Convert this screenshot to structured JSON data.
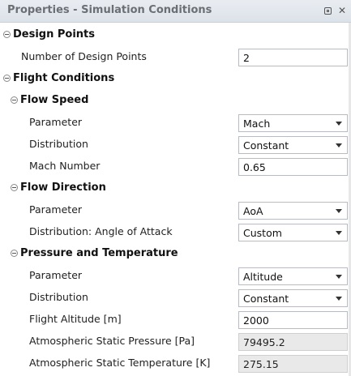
{
  "panel": {
    "title": "Properties - Simulation Conditions"
  },
  "design_points": {
    "label": "Design Points",
    "num_label": "Number of Design Points",
    "num_value": "2"
  },
  "flight_conditions": {
    "label": "Flight Conditions",
    "flow_speed": {
      "label": "Flow Speed",
      "parameter_label": "Parameter",
      "parameter_value": "Mach",
      "distribution_label": "Distribution",
      "distribution_value": "Constant",
      "mach_label": "Mach Number",
      "mach_value": "0.65"
    },
    "flow_direction": {
      "label": "Flow Direction",
      "parameter_label": "Parameter",
      "parameter_value": "AoA",
      "distribution_label": "Distribution: Angle of Attack",
      "distribution_value": "Custom"
    },
    "pressure_temperature": {
      "label": "Pressure and Temperature",
      "parameter_label": "Parameter",
      "parameter_value": "Altitude",
      "distribution_label": "Distribution",
      "distribution_value": "Constant",
      "altitude_label": "Flight Altitude [m]",
      "altitude_value": "2000",
      "pressure_label": "Atmospheric Static Pressure [Pa]",
      "pressure_value": "79495.2",
      "temperature_label": "Atmospheric Static Temperature [K]",
      "temperature_value": "275.15"
    }
  },
  "icons": {
    "collapse": "minus-circle-icon",
    "dropdown": "chevron-down-icon",
    "restore": "restore-window-icon",
    "close": "close-icon"
  }
}
